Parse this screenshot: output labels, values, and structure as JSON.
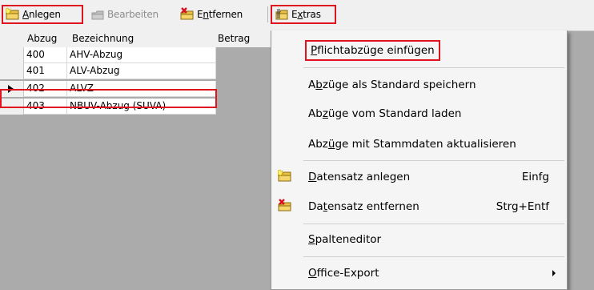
{
  "toolbar": {
    "anlegen": {
      "pre": "",
      "key": "A",
      "post": "nlegen",
      "icon": "folder-new-icon"
    },
    "bearbeiten": {
      "label": "Bearbeiten",
      "icon": "edit-icon"
    },
    "entfernen": {
      "pre": "E",
      "key": "n",
      "post": "tfernen",
      "icon": "folder-delete-icon"
    },
    "extras": {
      "pre": "E",
      "key": "x",
      "post": "tras",
      "icon": "folder-tools-icon"
    }
  },
  "grid": {
    "columns": [
      "Abzug",
      "Bezeichnung",
      "Betrag"
    ],
    "rows": [
      {
        "abzug": "400",
        "bezeichnung": "AHV-Abzug",
        "betrag": ""
      },
      {
        "abzug": "401",
        "bezeichnung": "ALV-Abzug",
        "betrag": ""
      },
      {
        "abzug": "402",
        "bezeichnung": "ALVZ",
        "betrag": ""
      },
      {
        "abzug": "403",
        "bezeichnung": "NBUV-Abzug (SUVA)",
        "betrag": ""
      }
    ],
    "selected_abzug": "402"
  },
  "menu": {
    "items": [
      {
        "pre": "",
        "key": "P",
        "post": "flichtabzüge einfügen"
      },
      {
        "pre": "A",
        "key": "b",
        "post": "züge als Standard speichern"
      },
      {
        "pre": "Ab",
        "key": "z",
        "post": "üge vom Standard laden"
      },
      {
        "pre": "Abz",
        "key": "ü",
        "post": "ge mit Stammdaten aktualisieren"
      },
      {
        "pre": "",
        "key": "D",
        "post": "atensatz anlegen",
        "shortcut": "Einfg",
        "icon": "folder-new-icon"
      },
      {
        "pre": "Da",
        "key": "t",
        "post": "ensatz entfernen",
        "shortcut": "Strg+Entf",
        "icon": "folder-delete-icon"
      },
      {
        "pre": "",
        "key": "S",
        "post": "palteneditor"
      },
      {
        "pre": "",
        "key": "O",
        "post": "ffice-Export",
        "submenu": true
      }
    ]
  },
  "colors": {
    "highlight": "#e0141e",
    "menu_bg": "#f5f5f5",
    "workspace": "#ababab"
  }
}
